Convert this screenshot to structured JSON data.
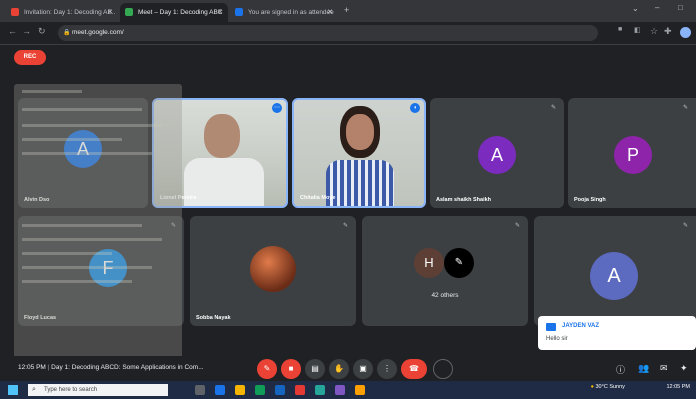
{
  "browser": {
    "tabs": [
      {
        "title": "Invitation: Day 1: Decoding AB..",
        "favicon": "gmail-icon",
        "active": false
      },
      {
        "title": "Meet – Day 1: Decoding ABC",
        "favicon": "meet-icon",
        "active": true
      },
      {
        "title": "You are signed in as attendee",
        "favicon": "info-icon",
        "active": false
      }
    ],
    "new_tab": "+",
    "url": "meet.google.com/"
  },
  "meet": {
    "rec_label": "REC",
    "participants": [
      {
        "name": "Alvin Dso",
        "initial": "A",
        "avatar_color": "#1a73e8"
      },
      {
        "name": "Lionel Pereira",
        "video": true
      },
      {
        "name": "Chitalia Moye",
        "video": true
      },
      {
        "name": "Aslam shaikh Shaikh",
        "initial": "A",
        "avatar_color": "#7b2bbd"
      },
      {
        "name": "Pooja Singh",
        "initial": "P",
        "avatar_color": "#8e24aa"
      },
      {
        "name": "Floyd Lucas",
        "initial": "F",
        "avatar_color": "#1a8fe8"
      },
      {
        "name": "Sobba Nayak",
        "photo": true
      },
      {
        "name": "42 others",
        "initials": [
          "H",
          ""
        ]
      },
      {
        "name": "",
        "initial": "A",
        "avatar_color": "#5c6bc0"
      }
    ],
    "meeting_time": "12:05 PM",
    "meeting_title": "Day 1: Decoding ABCD: Some Applications in Com...",
    "notification": {
      "sender": "JAYDEN VAZ",
      "message": "Hello sir"
    }
  },
  "taskbar": {
    "search_placeholder": "Type here to search",
    "weather": "30°C Sunny",
    "time": "12:05",
    "date": "PM"
  },
  "colors": {
    "accent_red": "#ea4335",
    "meet_bg": "#202124",
    "tile_bg": "#3c4043"
  }
}
